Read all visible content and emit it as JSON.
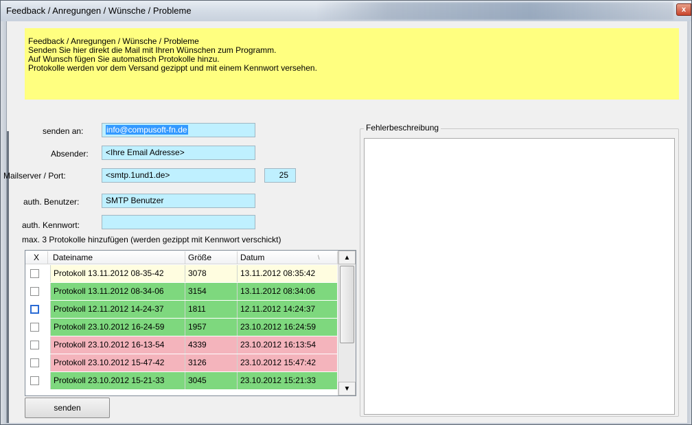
{
  "window": {
    "title": "Feedback / Anregungen / Wünsche / Probleme",
    "close_glyph": "x"
  },
  "info": {
    "lines": [
      "Feedback / Anregungen / Wünsche / Probleme",
      "Senden Sie hier direkt die Mail mit Ihren Wünschen zum Programm.",
      "Auf Wunsch fügen Sie automatisch Protokolle hinzu.",
      "Protokolle werden vor dem Versand gezippt und mit einem Kennwort versehen."
    ]
  },
  "form": {
    "send_to": {
      "label": "senden an:",
      "value": "info@compusoft-fn.de"
    },
    "sender": {
      "label": "Absender:",
      "value": "<Ihre Email Adresse>"
    },
    "mailserver": {
      "label": "Mailserver / Port:",
      "value": "<smtp.1und1.de>",
      "port": "25"
    },
    "auth_user": {
      "label": "auth. Benutzer:",
      "value": "SMTP Benutzer"
    },
    "auth_password": {
      "label": "auth. Kennwort:",
      "value": ""
    }
  },
  "protocols": {
    "hint": "max. 3 Protokolle hinzufügen (werden gezippt mit Kennwort verschickt)",
    "columns": [
      "X",
      "Dateiname",
      "Größe",
      "Datum"
    ],
    "sort_mark": "\\",
    "rows": [
      {
        "name": "Protokoll 13.11.2012 08-35-42",
        "size": "3078",
        "date": "13.11.2012 08:35:42",
        "color": "#fffde0"
      },
      {
        "name": "Protokoll 13.11.2012 08-34-06",
        "size": "3154",
        "date": "13.11.2012 08:34:06",
        "color": "#7ed87e"
      },
      {
        "name": "Protokoll 12.11.2012 14-24-37",
        "size": "1811",
        "date": "12.11.2012 14:24:37",
        "color": "#7ed87e"
      },
      {
        "name": "Protokoll 23.10.2012 16-24-59",
        "size": "1957",
        "date": "23.10.2012 16:24:59",
        "color": "#7ed87e"
      },
      {
        "name": "Protokoll 23.10.2012 16-13-54",
        "size": "4339",
        "date": "23.10.2012 16:13:54",
        "color": "#f4b4bc"
      },
      {
        "name": "Protokoll 23.10.2012 15-47-42",
        "size": "3126",
        "date": "23.10.2012 15:47:42",
        "color": "#f4b4bc"
      },
      {
        "name": "Protokoll 23.10.2012 15-21-33",
        "size": "3045",
        "date": "23.10.2012 15:21:33",
        "color": "#7ed87e"
      }
    ]
  },
  "buttons": {
    "send": "senden"
  },
  "error_box": {
    "label": "Fehlerbeschreibung",
    "value": ""
  }
}
